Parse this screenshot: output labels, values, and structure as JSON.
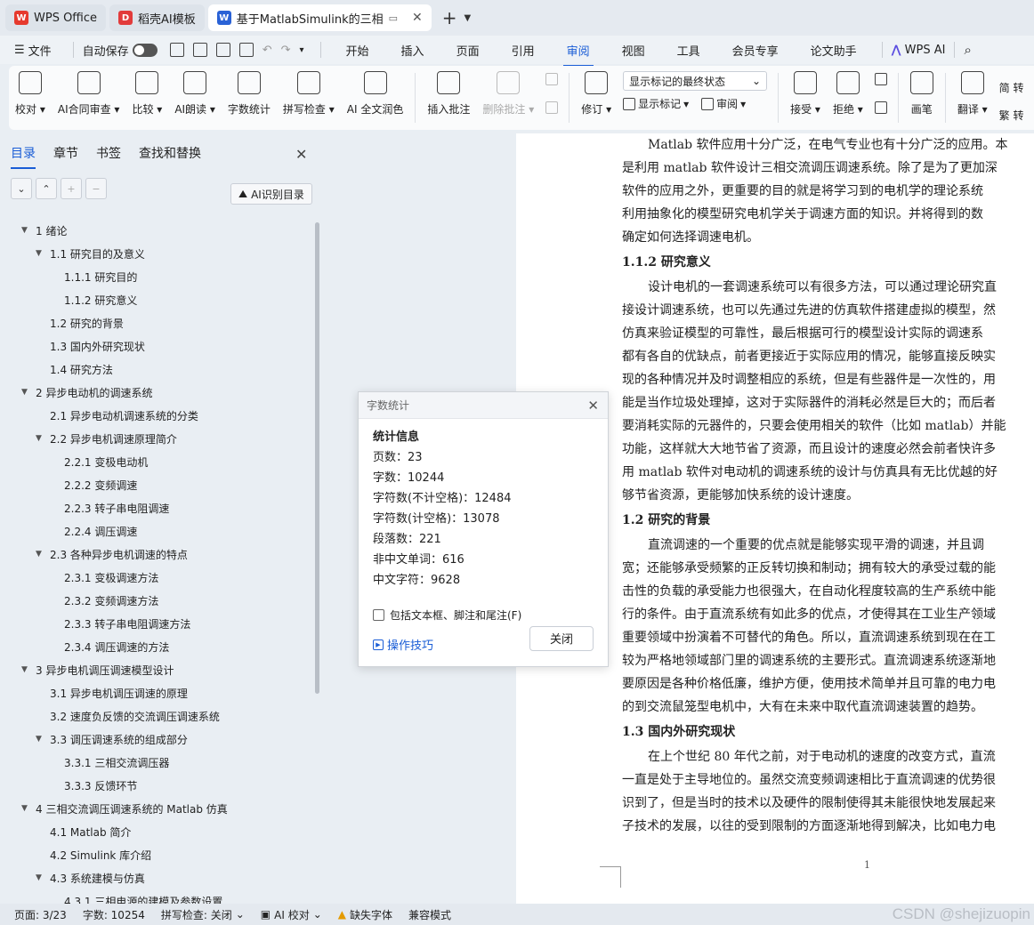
{
  "tabs": [
    {
      "label": "WPS Office",
      "icon_color": "#e63a2e",
      "icon_glyph": "W"
    },
    {
      "label": "稻壳AI模板",
      "icon_color": "#e23b3b",
      "icon_glyph": "D"
    },
    {
      "label": "基于MatlabSimulink的三相",
      "icon_color": "#2a62d6",
      "icon_glyph": "W"
    }
  ],
  "menubar": {
    "file": "文件",
    "autosave": "自动保存",
    "tabs": [
      "开始",
      "插入",
      "页面",
      "引用",
      "审阅",
      "视图",
      "工具",
      "会员专享",
      "论文助手"
    ],
    "active_tab": "审阅",
    "wps_ai": "WPS AI"
  },
  "ribbon": {
    "proofread": "校对",
    "ai_contract": "AI合同审查",
    "compare": "比较",
    "ai_read": "AI朗读",
    "word_count": "字数统计",
    "spell_check": "拼写检查",
    "ai_polish": "AI 全文润色",
    "insert_comment": "插入批注",
    "delete_comment": "删除批注",
    "revise": "修订",
    "markup_select": "显示标记的最终状态",
    "show_markup": "显示标记",
    "review": "审阅",
    "accept": "接受",
    "reject": "拒绝",
    "pen": "画笔",
    "translate": "翻译",
    "convert1": "简 转",
    "convert2": "繁 转"
  },
  "sidebar": {
    "tabs": [
      "目录",
      "章节",
      "书签",
      "查找和替换"
    ],
    "ai_toc": "AI识别目录",
    "toc": [
      {
        "text": "1  绪论",
        "level": 1,
        "arrow": true
      },
      {
        "text": "1.1  研究目的及意义",
        "level": 2,
        "arrow": true
      },
      {
        "text": "1.1.1  研究目的",
        "level": 3,
        "arrow": false
      },
      {
        "text": "1.1.2  研究意义",
        "level": 3,
        "arrow": false
      },
      {
        "text": "1.2  研究的背景",
        "level": 2,
        "arrow": false
      },
      {
        "text": "1.3  国内外研究现状",
        "level": 2,
        "arrow": false
      },
      {
        "text": "1.4  研究方法",
        "level": 2,
        "arrow": false
      },
      {
        "text": "2  异步电动机的调速系统",
        "level": 1,
        "arrow": true
      },
      {
        "text": "2.1  异步电动机调速系统的分类",
        "level": 2,
        "arrow": false
      },
      {
        "text": "2.2  异步电机调速原理简介",
        "level": 2,
        "arrow": true
      },
      {
        "text": "2.2.1  变极电动机",
        "level": 3,
        "arrow": false
      },
      {
        "text": "2.2.2  变频调速",
        "level": 3,
        "arrow": false
      },
      {
        "text": "2.2.3  转子串电阻调速",
        "level": 3,
        "arrow": false
      },
      {
        "text": "2.2.4  调压调速",
        "level": 3,
        "arrow": false
      },
      {
        "text": "2.3  各种异步电机调速的特点",
        "level": 2,
        "arrow": true
      },
      {
        "text": "2.3.1  变极调速方法",
        "level": 3,
        "arrow": false
      },
      {
        "text": "2.3.2  变频调速方法",
        "level": 3,
        "arrow": false
      },
      {
        "text": "2.3.3  转子串电阻调速方法",
        "level": 3,
        "arrow": false
      },
      {
        "text": "2.3.4  调压调速的方法",
        "level": 3,
        "arrow": false
      },
      {
        "text": "3  异步电机调压调速模型设计",
        "level": 1,
        "arrow": true
      },
      {
        "text": "3.1  异步电机调压调速的原理",
        "level": 2,
        "arrow": false
      },
      {
        "text": "3.2  速度负反馈的交流调压调速系统",
        "level": 2,
        "arrow": false
      },
      {
        "text": "3.3  调压调速系统的组成部分",
        "level": 2,
        "arrow": true
      },
      {
        "text": "3.3.1  三相交流调压器",
        "level": 3,
        "arrow": false
      },
      {
        "text": "3.3.3  反馈环节",
        "level": 3,
        "arrow": false
      },
      {
        "text": "4  三相交流调压调速系统的 Matlab 仿真",
        "level": 1,
        "arrow": true
      },
      {
        "text": "4.1 Matlab 简介",
        "level": 2,
        "arrow": false
      },
      {
        "text": "4.2 Simulink 库介绍",
        "level": 2,
        "arrow": false
      },
      {
        "text": "4.3  系统建模与仿真",
        "level": 2,
        "arrow": true
      },
      {
        "text": "4.3.1  三相电源的建模及参数设置",
        "level": 3,
        "arrow": false
      }
    ]
  },
  "document": {
    "lines": [
      {
        "type": "p",
        "indent": true,
        "text": "Matlab 软件应用十分广泛，在电气专业也有十分广泛的应用。本"
      },
      {
        "type": "p",
        "indent": false,
        "text": "是利用 matlab 软件设计三相交流调压调速系统。除了是为了更加深"
      },
      {
        "type": "p",
        "indent": false,
        "text": "软件的应用之外，更重要的目的就是将学习到的电机学的理论系统"
      },
      {
        "type": "p",
        "indent": false,
        "text": "利用抽象化的模型研究电机学关于调速方面的知识。并将得到的数"
      },
      {
        "type": "p",
        "indent": false,
        "text": "确定如何选择调速电机。"
      },
      {
        "type": "h",
        "text": "1.1.2  研究意义"
      },
      {
        "type": "p",
        "indent": true,
        "text": "设计电机的一套调速系统可以有很多方法，可以通过理论研究直"
      },
      {
        "type": "p",
        "indent": false,
        "text": "接设计调速系统，也可以先通过先进的仿真软件搭建虚拟的模型，然"
      },
      {
        "type": "p",
        "indent": false,
        "text": "仿真来验证模型的可靠性，最后根据可行的模型设计实际的调速系"
      },
      {
        "type": "p",
        "indent": false,
        "text": "都有各自的优缺点，前者更接近于实际应用的情况，能够直接反映实"
      },
      {
        "type": "p",
        "indent": false,
        "text": "现的各种情况并及时调整相应的系统，但是有些器件是一次性的，用"
      },
      {
        "type": "p",
        "indent": false,
        "text": "能是当作垃圾处理掉，这对于实际器件的消耗必然是巨大的；而后者"
      },
      {
        "type": "p",
        "indent": false,
        "text": "要消耗实际的元器件的，只要会使用相关的软件（比如 matlab）并能"
      },
      {
        "type": "p",
        "indent": false,
        "text": "功能，这样就大大地节省了资源，而且设计的速度必然会前者快许多"
      },
      {
        "type": "p",
        "indent": false,
        "text": "用 matlab 软件对电动机的调速系统的设计与仿真具有无比优越的好"
      },
      {
        "type": "p",
        "indent": false,
        "text": "够节省资源，更能够加快系统的设计速度。"
      },
      {
        "type": "h",
        "text": "1.2  研究的背景"
      },
      {
        "type": "p",
        "indent": true,
        "text": "直流调速的一个重要的优点就是能够实现平滑的调速，并且调"
      },
      {
        "type": "p",
        "indent": false,
        "text": "宽；还能够承受频繁的正反转切换和制动；拥有较大的承受过载的能"
      },
      {
        "type": "p",
        "indent": false,
        "text": "击性的负载的承受能力也很强大，在自动化程度较高的生产系统中能"
      },
      {
        "type": "p",
        "indent": false,
        "text": "行的条件。由于直流系统有如此多的优点，才使得其在工业生产领域"
      },
      {
        "type": "p",
        "indent": false,
        "text": "重要领域中扮演着不可替代的角色。所以，直流调速系统到现在在工"
      },
      {
        "type": "p",
        "indent": false,
        "text": "较为严格地领域部门里的调速系统的主要形式。直流调速系统逐渐地"
      },
      {
        "type": "p",
        "indent": false,
        "text": "要原因是各种价格低廉，维护方便，使用技术简单并且可靠的电力电"
      },
      {
        "type": "p",
        "indent": false,
        "text": "的到交流鼠笼型电机中，大有在未来中取代直流调速装置的趋势。"
      },
      {
        "type": "h",
        "text": "1.3  国内外研究现状"
      },
      {
        "type": "p",
        "indent": true,
        "text": "在上个世纪 80 年代之前，对于电动机的速度的改变方式，直流"
      },
      {
        "type": "p",
        "indent": false,
        "text": "一直是处于主导地位的。虽然交流变频调速相比于直流调速的优势很"
      },
      {
        "type": "p",
        "indent": false,
        "text": "识到了，但是当时的技术以及硬件的限制使得其未能很快地发展起来"
      },
      {
        "type": "p",
        "indent": false,
        "text": "子技术的发展，以往的受到限制的方面逐渐地得到解决，比如电力电"
      }
    ],
    "page_number": "1"
  },
  "dialog": {
    "title": "字数统计",
    "heading": "统计信息",
    "stats": [
      "页数：23",
      "字数：10244",
      "字符数(不计空格)：12484",
      "字符数(计空格)：13078",
      "段落数：221",
      "非中文单词：616",
      "中文字符：9628"
    ],
    "checkbox_label": "包括文本框、脚注和尾注(F)",
    "tips": "操作技巧",
    "close": "关闭"
  },
  "statusbar": {
    "page": "页面: 3/23",
    "words": "字数: 10254",
    "spell": "拼写检查: 关闭",
    "ai_proof": "AI 校对",
    "missing_font": "缺失字体",
    "compat": "兼容模式",
    "watermark": "CSDN @shejizuopin"
  },
  "colors": {
    "accent": "#1a5dd6"
  }
}
